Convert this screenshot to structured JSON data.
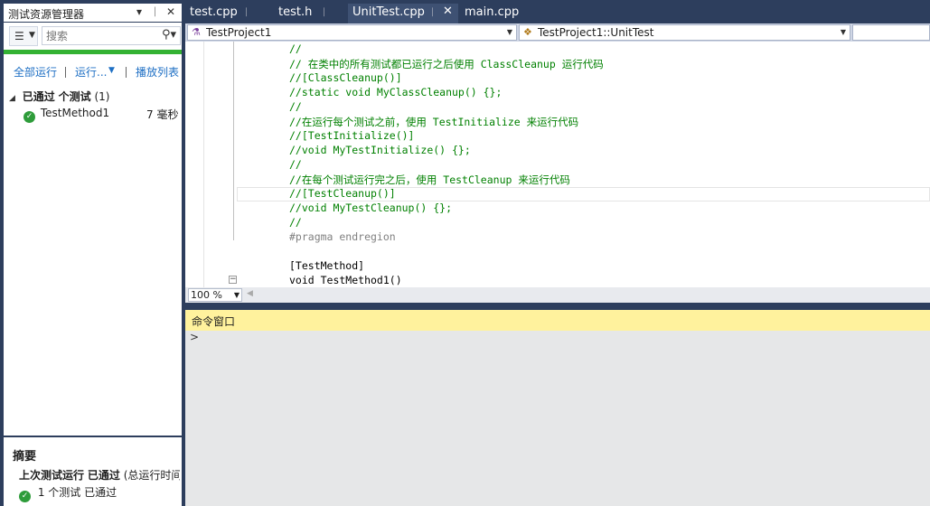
{
  "test_explorer": {
    "title": "测试资源管理器",
    "controls": [
      "▾",
      "ᛁ",
      "✕"
    ],
    "search_placeholder": "搜索",
    "links": {
      "run_all": "全部运行",
      "run": "运行...",
      "playlist": "播放列表"
    },
    "group": {
      "expander": "◢",
      "status": "已通过",
      "label": "个测试",
      "count": "(1)"
    },
    "test": {
      "name": "TestMethod1",
      "duration": "7 毫秒"
    },
    "summary": {
      "heading": "摘要",
      "last_run_label": "上次测试运行",
      "last_run_status": "已通过",
      "last_run_detail": "(总运行时间",
      "result": "1 个测试 已通过"
    }
  },
  "tabs": [
    {
      "label": "test.cpp",
      "pinned": true
    },
    {
      "label": "test.h",
      "pinned": true
    },
    {
      "label": "UnitTest.cpp",
      "pinned": true,
      "active": true
    },
    {
      "label": "main.cpp",
      "pinned": false
    }
  ],
  "nav": {
    "project": "TestProject1",
    "scope": "TestProject1::UnitTest"
  },
  "code_lines": [
    {
      "text": "//",
      "kind": "comment"
    },
    {
      "text": "// 在类中的所有测试都已运行之后使用 ClassCleanup 运行代码",
      "kind": "comment"
    },
    {
      "text": "//[ClassCleanup()]",
      "kind": "comment"
    },
    {
      "text": "//static void MyClassCleanup() {};",
      "kind": "comment"
    },
    {
      "text": "//",
      "kind": "comment"
    },
    {
      "text": "//在运行每个测试之前，使用 TestInitialize 来运行代码",
      "kind": "comment"
    },
    {
      "text": "//[TestInitialize()]",
      "kind": "comment"
    },
    {
      "text": "//void MyTestInitialize() {};",
      "kind": "comment"
    },
    {
      "text": "//",
      "kind": "comment"
    },
    {
      "text": "//在每个测试运行完之后，使用 TestCleanup 来运行代码",
      "kind": "comment"
    },
    {
      "text": "//[TestCleanup()]",
      "kind": "comment"
    },
    {
      "text": "//void MyTestCleanup() {};",
      "kind": "comment"
    },
    {
      "text": "//",
      "kind": "comment"
    },
    {
      "text": "#pragma endregion",
      "kind": "preprocessor"
    },
    {
      "text": "",
      "kind": "code"
    },
    {
      "text": "[TestMethod]",
      "kind": "code"
    },
    {
      "text": "void TestMethod1()",
      "kind": "code"
    }
  ],
  "zoom": "100 %",
  "command_window": {
    "title": "命令窗口",
    "prompt": ">"
  },
  "colors": {
    "chrome": "#2d3e5d",
    "progress_pass": "#34b233",
    "comment": "#008000",
    "cmd_title_bg": "#fff29d"
  }
}
